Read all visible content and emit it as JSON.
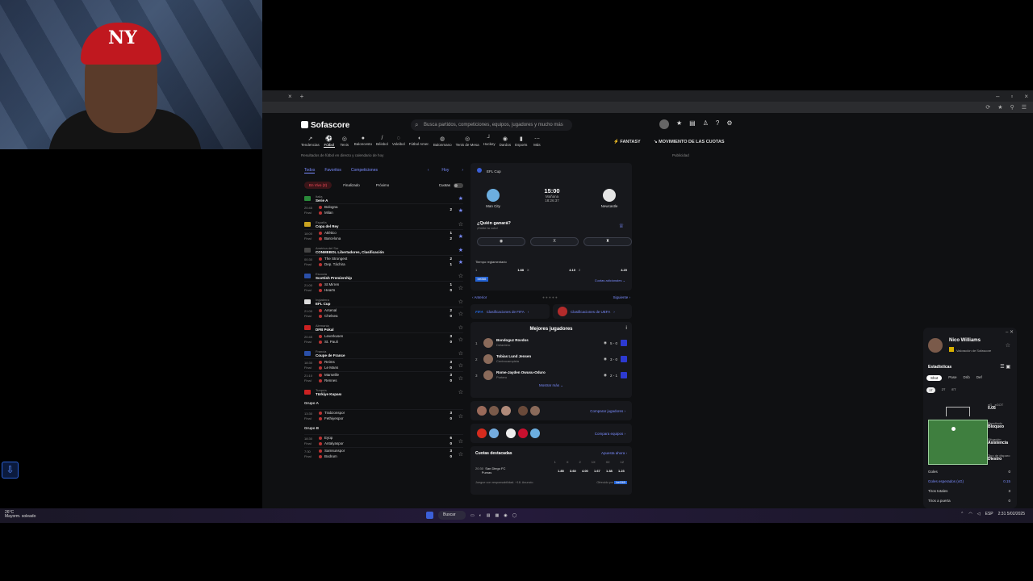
{
  "browser": {
    "tab_close": "×",
    "tab_add": "+",
    "window_controls": [
      "–",
      "▫",
      "×"
    ],
    "toolbar_icons": [
      "⟳",
      "★",
      "⚲",
      "☰"
    ]
  },
  "site": {
    "brand": "Sofascore",
    "search_placeholder": "Busca partidos, competiciones, equipos, jugadores y mucho más",
    "sports": [
      {
        "icon": "↗",
        "label": "Tendencias"
      },
      {
        "icon": "⚽",
        "label": "Fútbol"
      },
      {
        "icon": "◎",
        "label": "Tenis"
      },
      {
        "icon": "●",
        "label": "Baloncesto"
      },
      {
        "icon": "/",
        "label": "Béisbol"
      },
      {
        "icon": "◌",
        "label": "Voleibol"
      },
      {
        "icon": "◖",
        "label": "Fútbol Amer."
      },
      {
        "icon": "◍",
        "label": "Balonmano"
      },
      {
        "icon": "◎",
        "label": "Tenis de Mesa"
      },
      {
        "icon": "┘",
        "label": "Hockey"
      },
      {
        "icon": "◉",
        "label": "Dardos"
      },
      {
        "icon": "▮",
        "label": "Esports"
      },
      {
        "icon": "⋯",
        "label": "Más"
      }
    ],
    "fantasy": "FANTASY",
    "odds_movement": "MOVIMIENTO DE LAS CUOTAS",
    "subtitle": "Resultados de fútbol en directo y calendario de hoy",
    "advert": "Publicidad"
  },
  "left": {
    "tabs": [
      "Todos",
      "Favoritos",
      "Competiciones"
    ],
    "day": "Hoy",
    "filters": [
      "En Vivo (2)",
      "Finalizado",
      "Próximo"
    ],
    "odds_label": "Cuotas",
    "leagues": [
      {
        "country": "Italia",
        "name": "Serie A",
        "flag": "#2a8a3a",
        "fav": true,
        "matches": [
          {
            "time": "20:45",
            "status": "Final",
            "home": "Bologna",
            "away": "Milan",
            "hs": "",
            "as": "2",
            "fav": true
          }
        ]
      },
      {
        "country": "España",
        "name": "Copa del Rey",
        "flag": "#c9a320",
        "fav": false,
        "matches": [
          {
            "time": "18:00",
            "status": "Final",
            "home": "Atlético",
            "away": "Barcelona",
            "hs": "1",
            "as": "2",
            "fav": true
          }
        ]
      },
      {
        "country": "América del Sur",
        "name": "CONMEBOL Libertadores, Clasificación",
        "flag": "#444",
        "fav": true,
        "matches": [
          {
            "time": "00:30",
            "status": "Final",
            "home": "The Strongest",
            "away": "Dep. Táchira",
            "hs": "2",
            "as": "1",
            "fav": true
          }
        ]
      },
      {
        "country": "Escocia",
        "name": "Scottish Premiership",
        "flag": "#2a4fa8",
        "fav": false,
        "matches": [
          {
            "time": "21:00",
            "status": "Final",
            "home": "St Mirren",
            "away": "Hearts",
            "hs": "1",
            "as": "0",
            "fav": false
          }
        ]
      },
      {
        "country": "Inglaterra",
        "name": "EFL Cup",
        "flag": "#ddd",
        "fav": false,
        "matches": [
          {
            "time": "21:00",
            "status": "Final",
            "home": "Arsenal",
            "away": "Chelsea",
            "hs": "2",
            "as": "0",
            "fav": false
          }
        ]
      },
      {
        "country": "Alemania",
        "name": "DFB Pokal",
        "flag": "#c22",
        "fav": false,
        "matches": [
          {
            "time": "20:45",
            "status": "Final",
            "home": "Leverkusen",
            "away": "St. Pauli",
            "hs": "3",
            "as": "0",
            "fav": false
          }
        ]
      },
      {
        "country": "Francia",
        "name": "Coupe de France",
        "flag": "#2a4fa8",
        "fav": false,
        "matches": [
          {
            "time": "18:30",
            "status": "Final",
            "home": "Reims",
            "away": "Le Mans",
            "hs": "3",
            "as": "0",
            "fav": false
          },
          {
            "time": "21:10",
            "status": "Final",
            "home": "Marseille",
            "away": "Rennes",
            "hs": "3",
            "as": "0",
            "fav": false
          }
        ]
      },
      {
        "country": "Turquía",
        "name": "Türkiye Kupası",
        "flag": "#c22",
        "fav": false,
        "matches": []
      }
    ],
    "groups": [
      {
        "label": "Grupo A",
        "matches": [
          {
            "time": "13:30",
            "status": "Final",
            "home": "Trabzonspor",
            "away": "Fethiyespor",
            "hs": "3",
            "as": "0",
            "fav": false
          }
        ]
      },
      {
        "label": "Grupo B",
        "matches": [
          {
            "time": "18:30",
            "status": "Final",
            "home": "Eyüp",
            "away": "Antalyaspor",
            "hs": "6",
            "as": "0",
            "fav": false
          },
          {
            "time": "7:30",
            "status": "Final",
            "home": "Samsunspor",
            "away": "Bodrum",
            "hs": "3",
            "as": "0",
            "fav": false
          }
        ]
      }
    ]
  },
  "match_card": {
    "competition": "EFL Cup",
    "home": "Man City",
    "away": "Newcastle",
    "time": "15:00",
    "day": "Mañana",
    "countdown": "18:26:37",
    "vote_title": "¿Quién ganará?",
    "vote_sub": "¡Emite tu voto!",
    "vote_x": "X",
    "regular_time": "Tiempo reglamentario",
    "odds": [
      {
        "k": "1",
        "v": "1.88"
      },
      {
        "k": "X",
        "v": "4.10"
      },
      {
        "k": "2",
        "v": "4.20"
      }
    ],
    "bookmaker": "bet365",
    "more_odds": "Cuotas adicionales",
    "prev": "Anterior",
    "next": "Siguiente"
  },
  "rankings": {
    "fifa_logo": "FIFA",
    "fifa": "Clasificaciones de FIFA",
    "uefa": "Clasificaciones de UEFA"
  },
  "players": {
    "title": "Mejores jugadores",
    "info": "i",
    "list": [
      {
        "n": "1",
        "name": "Bondoguz Rovdos",
        "pos": "Delantero",
        "stat": "5 - 0"
      },
      {
        "n": "2",
        "name": "Tobias Lund Jensen",
        "pos": "Centrocampista",
        "stat": "3 - 0"
      },
      {
        "n": "3",
        "name": "Rome-Jayden Owusu-Oduro",
        "pos": "Portero",
        "stat": "2 - 1"
      }
    ],
    "more": "Mostrar más"
  },
  "compare": {
    "players_link": "Comparar jugadores",
    "teams_link": "Compara equipos"
  },
  "featured_odds": {
    "title": "Cuotas destacadas",
    "link": "Apuesta ahora",
    "cols": [
      "1",
      "X",
      "2",
      "1X",
      "X2",
      "12"
    ],
    "time": "20:30",
    "home": "San Diego FC",
    "away": "Pumas",
    "values": [
      "1.85",
      "3.60",
      "4.00",
      "1.67",
      "1.38",
      "1.23"
    ],
    "footer": "Juegue con responsabilidad. +18. Anuncio",
    "offered": "Ofrecido por"
  },
  "widget": {
    "name": "Nico Williams",
    "sub": "Valoración de Sofascore",
    "stats": "Estadísticas",
    "tabs": [
      "Shot",
      "Pase",
      "Drib",
      "Def"
    ],
    "halves": [
      "1T",
      "2T",
      "ET"
    ],
    "xg_label": "xG",
    "xg_value": "0.05",
    "xgot_label": "xGOT",
    "result_label": "Resultado",
    "result": "Bloqueo",
    "situation_label": "Situación",
    "situation": "Asistencia",
    "body_label": "Tipo de disparo",
    "body": "Diestro",
    "rows": [
      {
        "k": "Goles",
        "v": "0"
      },
      {
        "k": "Goles esperados (xG)",
        "v": "0.15"
      },
      {
        "k": "Tiros totales",
        "v": "3"
      },
      {
        "k": "Tiros a puerta",
        "v": "0"
      }
    ]
  },
  "taskbar": {
    "weather_temp": "26°C",
    "weather": "Mayorm. soleado",
    "search": "Buscar",
    "lang": "ESP",
    "time": "2:31",
    "date": "5/02/2025"
  }
}
